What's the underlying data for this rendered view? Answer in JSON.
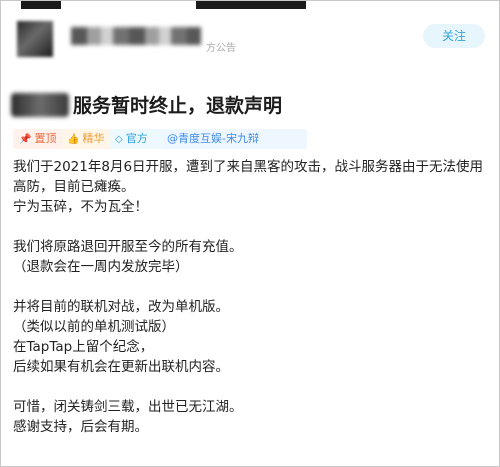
{
  "header": {
    "name_suffix": "方公告",
    "follow_label": "关注"
  },
  "title": {
    "text": "服务暂时终止，退款声明"
  },
  "tags": [
    {
      "icon": "pin-icon",
      "label": "置顶"
    },
    {
      "icon": "thumbs-up-icon",
      "label": "精华"
    },
    {
      "icon": "diamond-icon",
      "label": "官方"
    },
    {
      "icon": "at-icon",
      "label": "@青度互娱-宋九辩"
    }
  ],
  "body": {
    "p1": [
      "我们于2021年8月6日开服，遭到了来自黑客的攻击，战斗服务器由于无法使用",
      "高防，目前已瘫痪。",
      "宁为玉碎，不为瓦全！"
    ],
    "p2": [
      "我们将原路退回开服至今的所有充值。",
      "（退款会在一周内发放完毕）"
    ],
    "p3": [
      "并将目前的联机对战，改为单机版。",
      "（类似以前的单机测试版）",
      "在TapTap上留个纪念，",
      "后续如果有机会在更新出联机内容。"
    ],
    "p4": [
      "可惜，闭关铸剑三载，出世已无江湖。",
      "感谢支持，后会有期。"
    ]
  }
}
